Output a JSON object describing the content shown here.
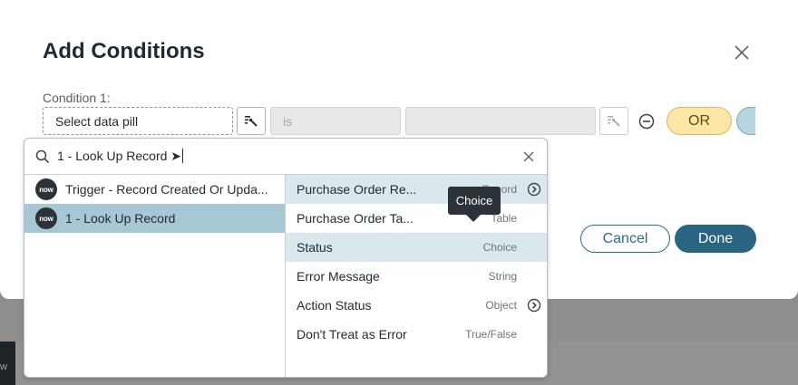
{
  "background": {
    "side_label": "w"
  },
  "modal": {
    "title": "Add Conditions",
    "condition_label": "Condition 1:",
    "data_pill_placeholder": "Select data pill",
    "operator_value": "is",
    "or_label": "OR",
    "cancel_label": "Cancel",
    "done_label": "Done"
  },
  "picker": {
    "search_value": "1 - Look Up Record ➤",
    "sources": [
      {
        "badge": "now",
        "label": "Trigger - Record Created Or Upda..."
      },
      {
        "badge": "now",
        "label": "1 - Look Up Record"
      }
    ],
    "fields": [
      {
        "name": "Purchase Order Re...",
        "type": "Record"
      },
      {
        "name": "Purchase Order Ta...",
        "type": "Table"
      },
      {
        "name": "Status",
        "type": "Choice"
      },
      {
        "name": "Error Message",
        "type": "String"
      },
      {
        "name": "Action Status",
        "type": "Object"
      },
      {
        "name": "Don't Treat as Error",
        "type": "True/False"
      }
    ],
    "tooltip": "Choice"
  },
  "colors": {
    "primary": "#2a6480",
    "selected_row": "#a6c7d3",
    "hover_row": "#dae7ed",
    "or_pill": "#fbe6a5",
    "badge": "#2b3338"
  }
}
